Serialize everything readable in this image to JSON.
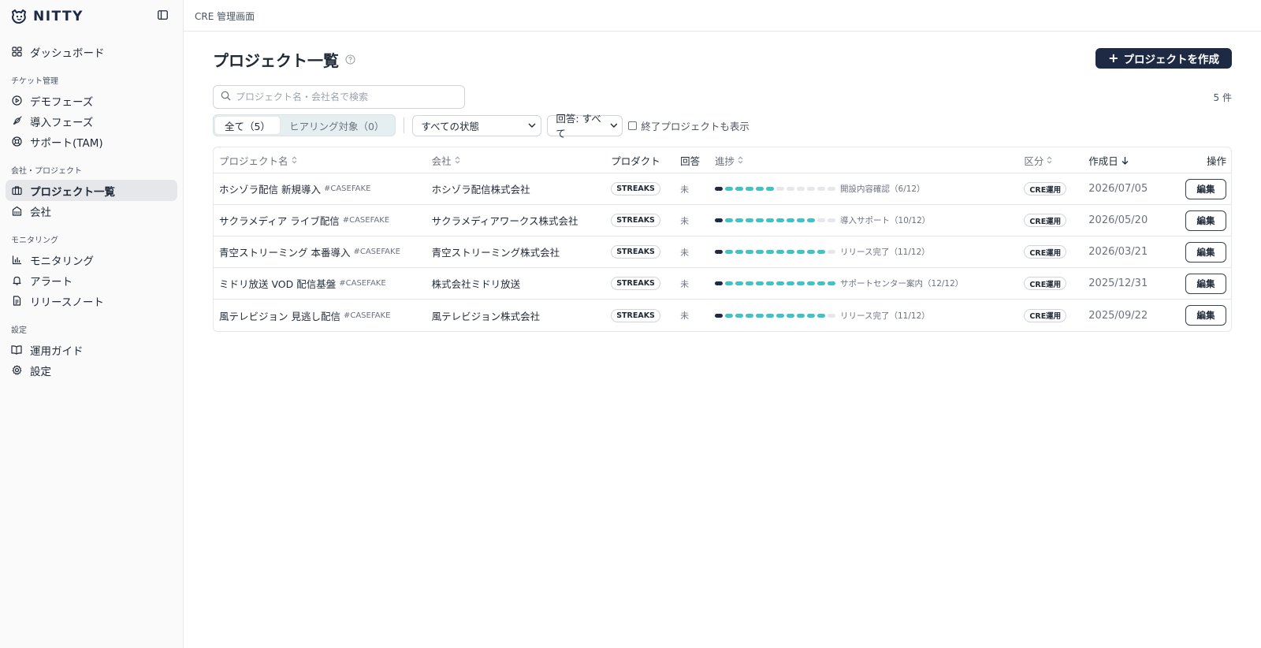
{
  "brand": {
    "name": "NITTY"
  },
  "topbar": {
    "title": "CRE 管理画面"
  },
  "sidebar": {
    "top_items": [
      {
        "label": "ダッシュボード",
        "icon": "dashboard-icon"
      }
    ],
    "sections": [
      {
        "title": "チケット管理",
        "items": [
          {
            "label": "デモフェーズ",
            "icon": "play-circle-icon"
          },
          {
            "label": "導入フェーズ",
            "icon": "rocket-icon"
          },
          {
            "label": "サポート(TAM)",
            "icon": "lifebuoy-icon"
          }
        ]
      },
      {
        "title": "会社・プロジェクト",
        "items": [
          {
            "label": "プロジェクト一覧",
            "icon": "briefcase-icon",
            "active": true
          },
          {
            "label": "会社",
            "icon": "building-icon"
          }
        ]
      },
      {
        "title": "モニタリング",
        "items": [
          {
            "label": "モニタリング",
            "icon": "bar-chart-icon"
          },
          {
            "label": "アラート",
            "icon": "bell-icon"
          },
          {
            "label": "リリースノート",
            "icon": "file-text-icon"
          }
        ]
      },
      {
        "title": "設定",
        "items": [
          {
            "label": "運用ガイド",
            "icon": "book-open-icon"
          },
          {
            "label": "設定",
            "icon": "gear-icon"
          }
        ]
      }
    ]
  },
  "main": {
    "title": "プロジェクト一覧",
    "create_button": "プロジェクトを作成",
    "search_placeholder": "プロジェクト名・会社名で検索",
    "count": "5 件",
    "segments": [
      {
        "label": "全て（5）",
        "active": true
      },
      {
        "label": "ヒアリング対象（0）",
        "active": false
      }
    ],
    "status_select": "すべての状態",
    "answer_select": "回答: すべて",
    "show_finished": "終了プロジェクトも表示",
    "columns": {
      "project": "プロジェクト名",
      "company": "会社",
      "product": "プロダクト",
      "answer": "回答",
      "progress": "進捗",
      "category": "区分",
      "created": "作成日",
      "actions": "操作"
    },
    "rows": [
      {
        "project": "ホシゾラ配信 新規導入",
        "tag": "#CASEFAKE",
        "company": "ホシゾラ配信株式会社",
        "product": "STREAKS",
        "answer": "未",
        "progress_done": 6,
        "progress_total": 12,
        "progress_label": "開設内容確認（6/12）",
        "category": "CRE運用",
        "created": "2026/07/05",
        "action": "編集"
      },
      {
        "project": "サクラメディア ライブ配信",
        "tag": "#CASEFAKE",
        "company": "サクラメディアワークス株式会社",
        "product": "STREAKS",
        "answer": "未",
        "progress_done": 10,
        "progress_total": 12,
        "progress_label": "導入サポート（10/12）",
        "category": "CRE運用",
        "created": "2026/05/20",
        "action": "編集"
      },
      {
        "project": "青空ストリーミング 本番導入",
        "tag": "#CASEFAKE",
        "company": "青空ストリーミング株式会社",
        "product": "STREAKS",
        "answer": "未",
        "progress_done": 11,
        "progress_total": 12,
        "progress_label": "リリース完了（11/12）",
        "category": "CRE運用",
        "created": "2026/03/21",
        "action": "編集"
      },
      {
        "project": "ミドリ放送 VOD 配信基盤",
        "tag": "#CASEFAKE",
        "company": "株式会社ミドリ放送",
        "product": "STREAKS",
        "answer": "未",
        "progress_done": 12,
        "progress_total": 12,
        "progress_label": "サポートセンター案内（12/12）",
        "category": "CRE運用",
        "created": "2025/12/31",
        "action": "編集"
      },
      {
        "project": "風テレビジョン 見逃し配信",
        "tag": "#CASEFAKE",
        "company": "風テレビジョン株式会社",
        "product": "STREAKS",
        "answer": "未",
        "progress_done": 11,
        "progress_total": 12,
        "progress_label": "リリース完了（11/12）",
        "category": "CRE運用",
        "created": "2025/09/22",
        "action": "編集"
      }
    ]
  },
  "colors": {
    "brand": "#1e2a44",
    "progress_done": "#3fc3c6",
    "progress_first": "#1e2a44",
    "progress_empty": "#e5e7eb"
  }
}
